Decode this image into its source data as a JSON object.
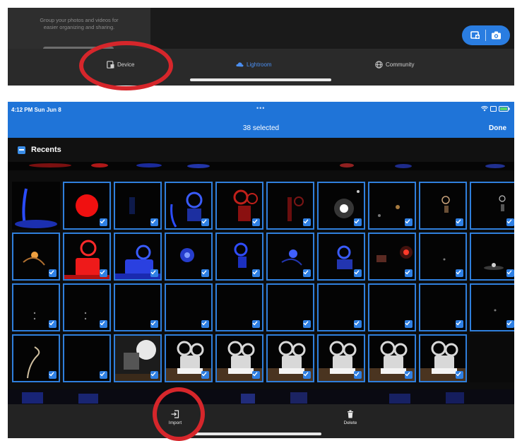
{
  "top_panel": {
    "card_caption_line1": "Group your photos and videos for",
    "card_caption_line2": "easier organizing and sharing.",
    "tabs": [
      {
        "label": "Device",
        "icon": "device-icon",
        "active": false
      },
      {
        "label": "Lightroom",
        "icon": "cloud-icon",
        "active": true
      },
      {
        "label": "Community",
        "icon": "globe-icon",
        "active": false
      }
    ],
    "fab_icons": [
      "add-photo-icon",
      "camera-icon"
    ]
  },
  "status_bar": {
    "time": "4:12 PM  Sun Jun 8",
    "dots": "•••",
    "icons": [
      "wifi-icon",
      "signal-icon",
      "battery-icon"
    ]
  },
  "nav": {
    "title": "38 selected",
    "done": "Done"
  },
  "section": {
    "label": "Recents"
  },
  "grid": {
    "columns": 10,
    "rows": [
      [
        "blue-glow",
        "red-circle",
        "dark-blue",
        "blue-projector",
        "red-projector",
        "red-reel",
        "white-light",
        "dark-warm",
        "dark-reel",
        "dark-reel-small"
      ],
      [
        "warm-light",
        "red-projector-bright",
        "blue-projector-bright",
        "blue-lamp",
        "blue-reel",
        "blue-lamp-small",
        "blue-projector-small",
        "red-light",
        "dark-spot",
        "dark-lens"
      ],
      [
        "dark-dots",
        "dark-dots",
        "dark",
        "dark",
        "dark",
        "dark",
        "dark",
        "dark",
        "dark",
        "dark-spot"
      ],
      [
        "warm-wire",
        "dark",
        "projector-lamp",
        "projector-white",
        "projector-white",
        "projector-white",
        "projector-white",
        "projector-white",
        "projector-white",
        "empty"
      ]
    ],
    "selected": [
      [
        false,
        true,
        true,
        true,
        true,
        true,
        true,
        true,
        true,
        true
      ],
      [
        true,
        true,
        true,
        true,
        true,
        true,
        true,
        true,
        true,
        true
      ],
      [
        true,
        true,
        true,
        true,
        true,
        true,
        true,
        true,
        true,
        true
      ],
      [
        true,
        true,
        true,
        true,
        true,
        true,
        true,
        true,
        true,
        false
      ]
    ]
  },
  "toolbar": {
    "import_label": "Import",
    "delete_label": "Delete",
    "import_icon": "import-icon",
    "delete_icon": "trash-icon"
  },
  "colors": {
    "accent": "#1f74d8",
    "selection": "#2f7fdc",
    "annotation": "#d6262b"
  }
}
